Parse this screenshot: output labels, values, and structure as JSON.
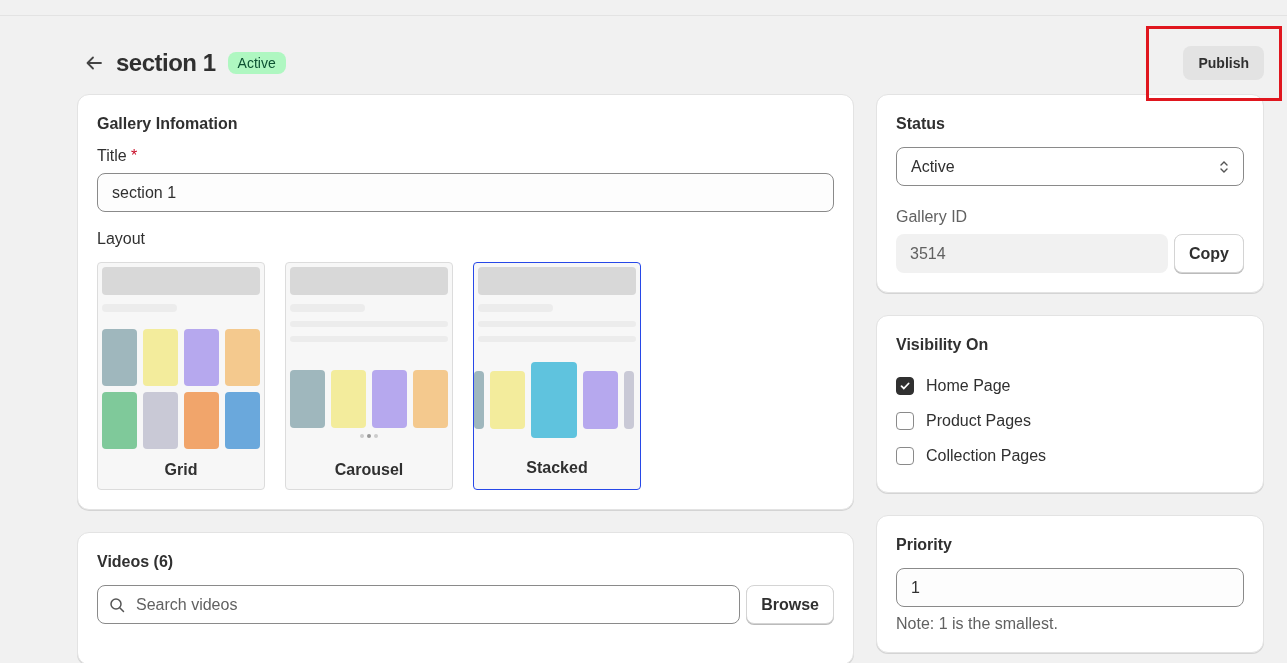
{
  "header": {
    "title": "section 1",
    "badge": "Active",
    "publish": "Publish",
    "publish_highlighted": true
  },
  "gallery": {
    "heading": "Gallery Infomation",
    "title_label": "Title",
    "required_mark": "*",
    "title_value": "section 1",
    "layout_label": "Layout",
    "layouts": [
      {
        "kind": "grid",
        "label": "Grid",
        "selected": false
      },
      {
        "kind": "carousel",
        "label": "Carousel",
        "selected": false
      },
      {
        "kind": "stacked",
        "label": "Stacked",
        "selected": true
      }
    ]
  },
  "videos": {
    "heading": "Videos (6)",
    "search_placeholder": "Search videos",
    "browse": "Browse"
  },
  "status": {
    "heading": "Status",
    "value": "Active",
    "id_label": "Gallery ID",
    "id_value": "3514",
    "copy": "Copy"
  },
  "visibility": {
    "heading": "Visibility On",
    "options": [
      {
        "label": "Home Page",
        "checked": true
      },
      {
        "label": "Product Pages",
        "checked": false
      },
      {
        "label": "Collection Pages",
        "checked": false
      }
    ]
  },
  "priority": {
    "heading": "Priority",
    "value": "1",
    "note": "Note: 1 is the smallest."
  }
}
